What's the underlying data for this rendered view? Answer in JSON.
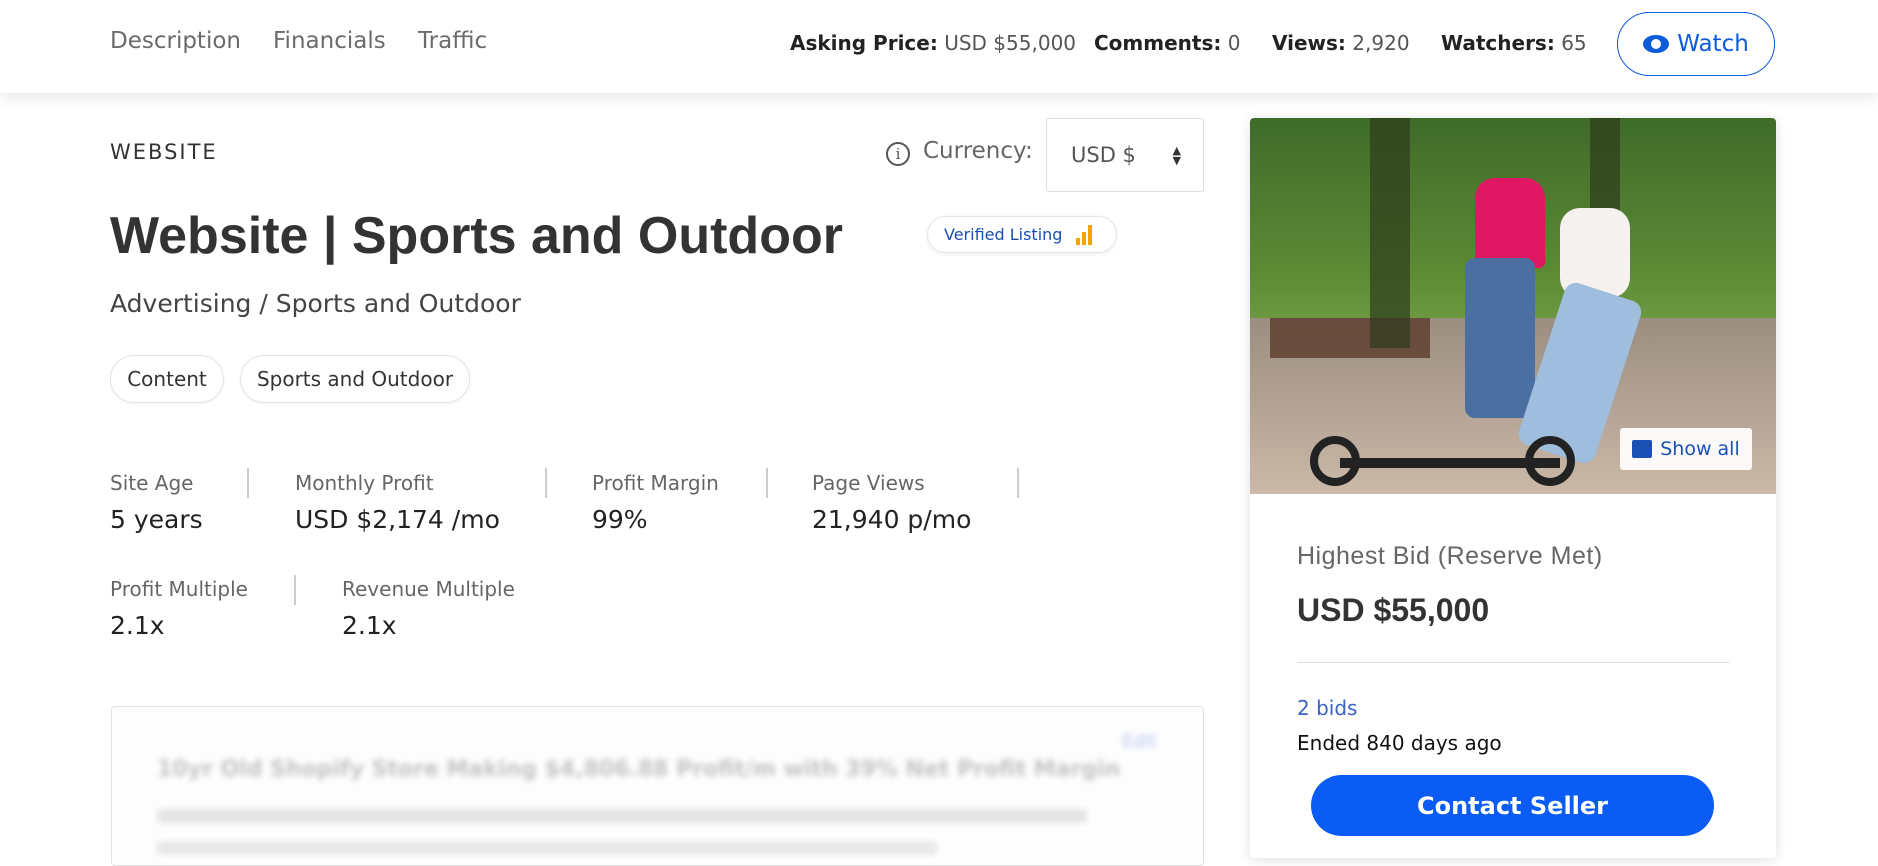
{
  "header": {
    "nav": [
      "Description",
      "Financials",
      "Traffic"
    ],
    "stats": [
      {
        "label": "Asking Price:",
        "value": "USD $55,000"
      },
      {
        "label": "Comments:",
        "value": "0"
      },
      {
        "label": "Views:",
        "value": "2,920"
      },
      {
        "label": "Watchers:",
        "value": "65"
      }
    ],
    "watch_label": "Watch",
    "watch_icon": "eye-icon"
  },
  "listing": {
    "type": "WEBSITE",
    "currency_label": "Currency:",
    "currency_value": "USD $",
    "title": "Website | Sports and Outdoor",
    "badge": "Verified Listing",
    "subtitle": "Advertising / Sports and Outdoor",
    "tags": [
      "Content",
      "Sports and Outdoor"
    ],
    "metrics_row1": [
      {
        "label": "Site Age",
        "value": "5 years"
      },
      {
        "label": "Monthly Profit",
        "value": "USD $2,174 /mo"
      },
      {
        "label": "Profit Margin",
        "value": "99%"
      },
      {
        "label": "Page Views",
        "value": "21,940 p/mo"
      }
    ],
    "metrics_row2": [
      {
        "label": "Profit Multiple",
        "value": "2.1x"
      },
      {
        "label": "Revenue Multiple",
        "value": "2.1x"
      }
    ],
    "blurred_heading": "10yr Old Shopify Store Making $4,806.88 Profit/m with 39% Net Profit Margin",
    "blurred_edit": "Edit"
  },
  "sidebar": {
    "show_all": "Show all",
    "bid_label": "Highest Bid (Reserve Met)",
    "bid_value": "USD $55,000",
    "bids": "2 bids",
    "ended": "Ended 840 days ago",
    "contact": "Contact Seller"
  },
  "colors": {
    "accent": "#0a5cf5",
    "link": "#1a4fb3",
    "badge_bars": "#f4a300"
  }
}
